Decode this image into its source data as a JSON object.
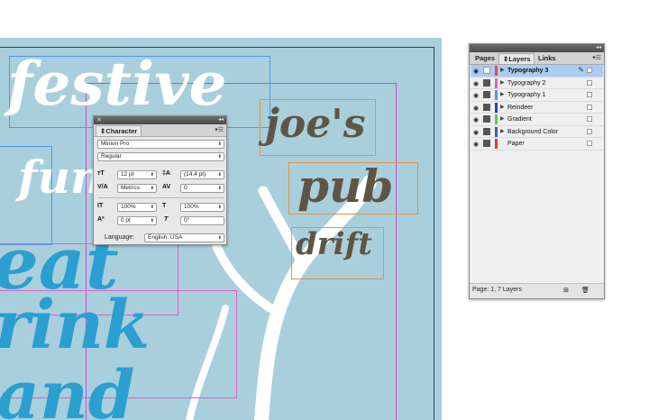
{
  "canvas": {
    "poster_white_lines": [
      "festive",
      "fun"
    ],
    "poster_blue_lines": [
      "eat",
      "rink",
      "and"
    ],
    "poster_brown_lines": [
      "joe's",
      "pub",
      "drift"
    ]
  },
  "character_panel": {
    "tab_label": "Character",
    "font_family": "Minion Pro",
    "font_style": "Regular",
    "font_size": "12 pt",
    "leading": "(14.4 pt)",
    "kerning": "Metrics",
    "tracking": "0",
    "vertical_scale": "100%",
    "horizontal_scale": "100%",
    "baseline_shift": "0 pt",
    "skew": "0°",
    "language_label": "Language:",
    "language": "English: USA"
  },
  "layers_panel": {
    "tabs": [
      "Pages",
      "Layers",
      "Links"
    ],
    "active_tab_label": "Layers",
    "layers": [
      {
        "name": "Typography 3",
        "color": "#e24c2e",
        "selected": true
      },
      {
        "name": "Typography 2",
        "color": "#e25ec7",
        "selected": false
      },
      {
        "name": "Typography 1",
        "color": "#4a9be8",
        "selected": false
      },
      {
        "name": "Reindeer",
        "color": "#2a3fc0",
        "selected": false
      },
      {
        "name": "Gradient",
        "color": "#59c95a",
        "selected": false
      },
      {
        "name": "Background Color",
        "color": "#3a57d6",
        "selected": false
      },
      {
        "name": "Paper",
        "color": "#d83a3a",
        "selected": false
      }
    ],
    "footer_status": "Page: 1, 7 Layers"
  }
}
